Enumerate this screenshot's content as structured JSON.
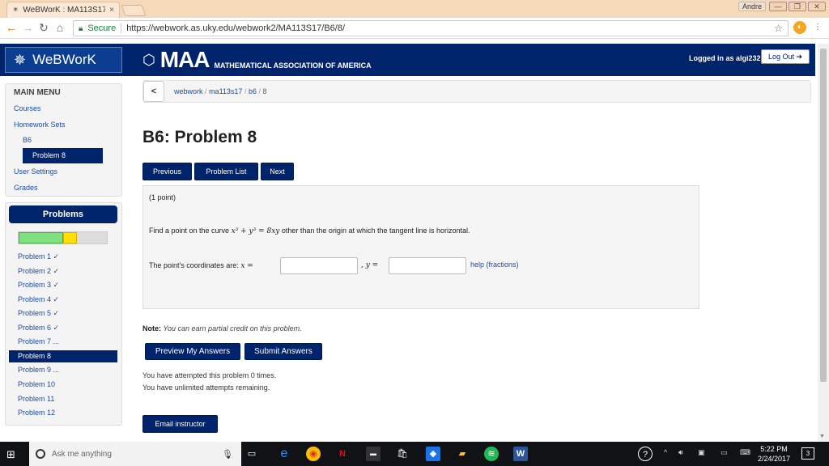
{
  "browser": {
    "tab_title": "WeBWorK : MA113S17 :",
    "tab_close": "×",
    "profile": "Andre",
    "secure_label": "Secure",
    "url": "https://webwork.as.uky.edu/webwork2/MA113S17/B6/8/",
    "win_min": "—",
    "win_max": "❐",
    "win_close": "✕"
  },
  "banner": {
    "brand": "WeBWorK",
    "maa_logo": "MAA",
    "maa_subtitle": "MATHEMATICAL ASSOCIATION OF AMERICA",
    "login_text": "Logged in as algi232.",
    "logout": "Log Out ➜"
  },
  "main_menu": {
    "title": "MAIN MENU",
    "courses": "Courses",
    "homework_sets": "Homework Sets",
    "set": "B6",
    "active_problem": "Problem 8",
    "user_settings": "User Settings",
    "grades": "Grades"
  },
  "problems_panel": {
    "title": "Problems",
    "progress_correct": 0.5,
    "progress_partial": 0.16,
    "items": [
      "Problem 1 ✓",
      "Problem 2 ✓",
      "Problem 3 ✓",
      "Problem 4 ✓",
      "Problem 5 ✓",
      "Problem 6 ✓",
      "Problem 7 ...",
      "Problem 8",
      "Problem 9 ...",
      "Problem 10",
      "Problem 11",
      "Problem 12"
    ]
  },
  "breadcrumb": {
    "back": "<",
    "items": [
      "webwork",
      "ma113s17",
      "b6",
      "8"
    ],
    "divider": "/"
  },
  "page": {
    "title": "B6: Problem 8",
    "btn_previous": "Previous",
    "btn_list": "Problem List",
    "btn_next": "Next"
  },
  "problem": {
    "points": "(1 point)",
    "text_before": "Find a point on the curve",
    "equation": "x³ + y³ = 8xy",
    "text_after": "other than the origin at which the tangent line is horizontal.",
    "coord_label": "The point's coordinates are:",
    "x_label": "x =",
    "comma_y": ", y =",
    "x_value": "",
    "y_value": "",
    "help": "help (fractions)"
  },
  "note": {
    "label": "Note:",
    "text": "You can earn partial credit on this problem."
  },
  "actions": {
    "preview": "Preview My Answers",
    "submit": "Submit Answers"
  },
  "attempts": {
    "line1": "You have attempted this problem 0 times.",
    "line2": "You have unlimited attempts remaining."
  },
  "email": "Email instructor",
  "taskbar": {
    "search_placeholder": "Ask me anything",
    "time": "5:22 PM",
    "date": "2/24/2017",
    "notifications": "3"
  },
  "colors": {
    "navy": "#00246b",
    "link": "#1e4b9c",
    "progress_green": "#7ee07e",
    "progress_yellow": "#ffe000"
  }
}
